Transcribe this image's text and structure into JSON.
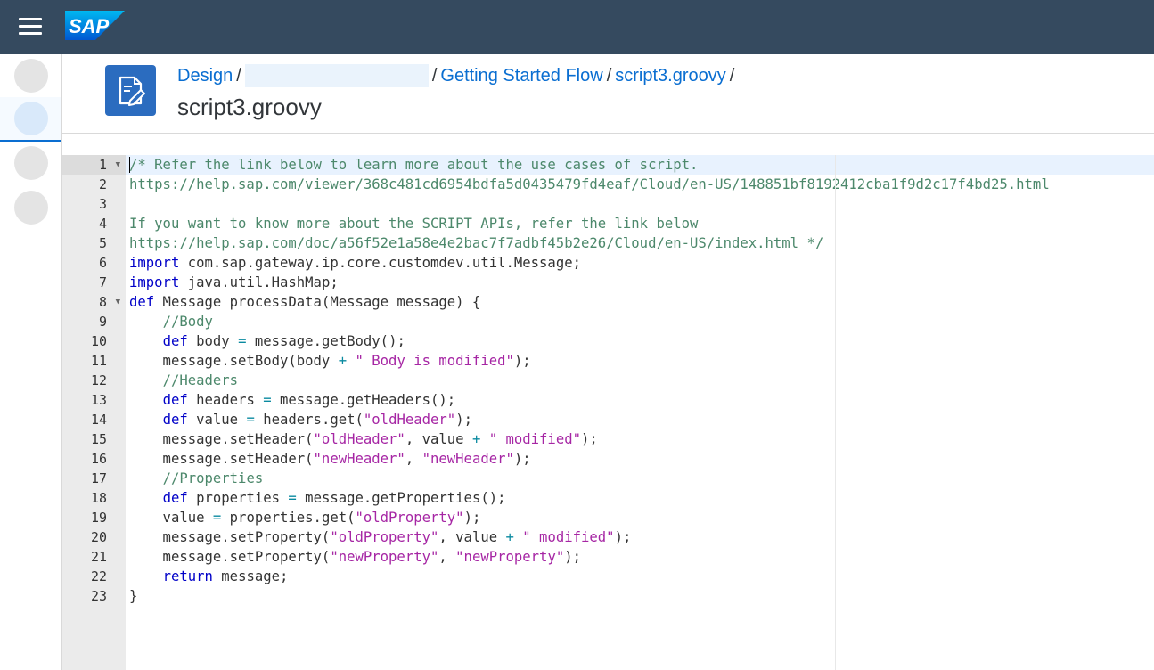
{
  "shell": {
    "logo_text": "SAP",
    "brand_color": "#354a5f"
  },
  "side_nav": {
    "items": [
      {
        "icon": "nav-circle",
        "selected": false
      },
      {
        "icon": "nav-circle",
        "selected": true
      },
      {
        "icon": "nav-circle",
        "selected": false
      },
      {
        "icon": "nav-circle",
        "selected": false
      }
    ]
  },
  "header": {
    "icon": "script-edit-icon",
    "breadcrumb": {
      "design": "Design",
      "package": "",
      "flow": "Getting Started Flow",
      "file": "script3.groovy",
      "separator": "/"
    },
    "title": "script3.groovy"
  },
  "editor": {
    "active_line": 1,
    "line_numbers": [
      "1",
      "2",
      "3",
      "4",
      "5",
      "6",
      "7",
      "8",
      "9",
      "10",
      "11",
      "12",
      "13",
      "14",
      "15",
      "16",
      "17",
      "18",
      "19",
      "20",
      "21",
      "22",
      "23"
    ],
    "fold_lines": [
      1,
      8
    ],
    "lines": [
      [
        [
          "comment",
          "/* Refer the link below to learn more about the use cases of script."
        ]
      ],
      [
        [
          "comment",
          "https://help.sap.com/viewer/368c481cd6954bdfa5d0435479fd4eaf/Cloud/en-US/148851bf8192412cba1f9d2c17f4bd25.html"
        ]
      ],
      [
        [
          "comment",
          ""
        ]
      ],
      [
        [
          "comment",
          "If you want to know more about the SCRIPT APIs, refer the link below"
        ]
      ],
      [
        [
          "comment",
          "https://help.sap.com/doc/a56f52e1a58e4e2bac7f7adbf45b2e26/Cloud/en-US/index.html */"
        ]
      ],
      [
        [
          "keyword",
          "import"
        ],
        [
          "plain",
          " com.sap.gateway.ip.core.customdev.util.Message;"
        ]
      ],
      [
        [
          "keyword",
          "import"
        ],
        [
          "plain",
          " java.util.HashMap;"
        ]
      ],
      [
        [
          "keyword",
          "def"
        ],
        [
          "plain",
          " Message processData(Message message) {"
        ]
      ],
      [
        [
          "plain",
          "    "
        ],
        [
          "comment",
          "//Body"
        ]
      ],
      [
        [
          "plain",
          "    "
        ],
        [
          "keyword",
          "def"
        ],
        [
          "plain",
          " body "
        ],
        [
          "op",
          "="
        ],
        [
          "plain",
          " message.getBody();"
        ]
      ],
      [
        [
          "plain",
          "    message.setBody(body "
        ],
        [
          "op",
          "+"
        ],
        [
          "plain",
          " "
        ],
        [
          "string",
          "\" Body is modified\""
        ],
        [
          "plain",
          ");"
        ]
      ],
      [
        [
          "plain",
          "    "
        ],
        [
          "comment",
          "//Headers"
        ]
      ],
      [
        [
          "plain",
          "    "
        ],
        [
          "keyword",
          "def"
        ],
        [
          "plain",
          " headers "
        ],
        [
          "op",
          "="
        ],
        [
          "plain",
          " message.getHeaders();"
        ]
      ],
      [
        [
          "plain",
          "    "
        ],
        [
          "keyword",
          "def"
        ],
        [
          "plain",
          " value "
        ],
        [
          "op",
          "="
        ],
        [
          "plain",
          " headers.get("
        ],
        [
          "string",
          "\"oldHeader\""
        ],
        [
          "plain",
          ");"
        ]
      ],
      [
        [
          "plain",
          "    message.setHeader("
        ],
        [
          "string",
          "\"oldHeader\""
        ],
        [
          "plain",
          ", value "
        ],
        [
          "op",
          "+"
        ],
        [
          "plain",
          " "
        ],
        [
          "string",
          "\" modified\""
        ],
        [
          "plain",
          ");"
        ]
      ],
      [
        [
          "plain",
          "    message.setHeader("
        ],
        [
          "string",
          "\"newHeader\""
        ],
        [
          "plain",
          ", "
        ],
        [
          "string",
          "\"newHeader\""
        ],
        [
          "plain",
          ");"
        ]
      ],
      [
        [
          "plain",
          "    "
        ],
        [
          "comment",
          "//Properties"
        ]
      ],
      [
        [
          "plain",
          "    "
        ],
        [
          "keyword",
          "def"
        ],
        [
          "plain",
          " properties "
        ],
        [
          "op",
          "="
        ],
        [
          "plain",
          " message.getProperties();"
        ]
      ],
      [
        [
          "plain",
          "    value "
        ],
        [
          "op",
          "="
        ],
        [
          "plain",
          " properties.get("
        ],
        [
          "string",
          "\"oldProperty\""
        ],
        [
          "plain",
          ");"
        ]
      ],
      [
        [
          "plain",
          "    message.setProperty("
        ],
        [
          "string",
          "\"oldProperty\""
        ],
        [
          "plain",
          ", value "
        ],
        [
          "op",
          "+"
        ],
        [
          "plain",
          " "
        ],
        [
          "string",
          "\" modified\""
        ],
        [
          "plain",
          ");"
        ]
      ],
      [
        [
          "plain",
          "    message.setProperty("
        ],
        [
          "string",
          "\"newProperty\""
        ],
        [
          "plain",
          ", "
        ],
        [
          "string",
          "\"newProperty\""
        ],
        [
          "plain",
          ");"
        ]
      ],
      [
        [
          "plain",
          "    "
        ],
        [
          "keyword",
          "return"
        ],
        [
          "plain",
          " message;"
        ]
      ],
      [
        [
          "plain",
          "}"
        ]
      ]
    ]
  }
}
